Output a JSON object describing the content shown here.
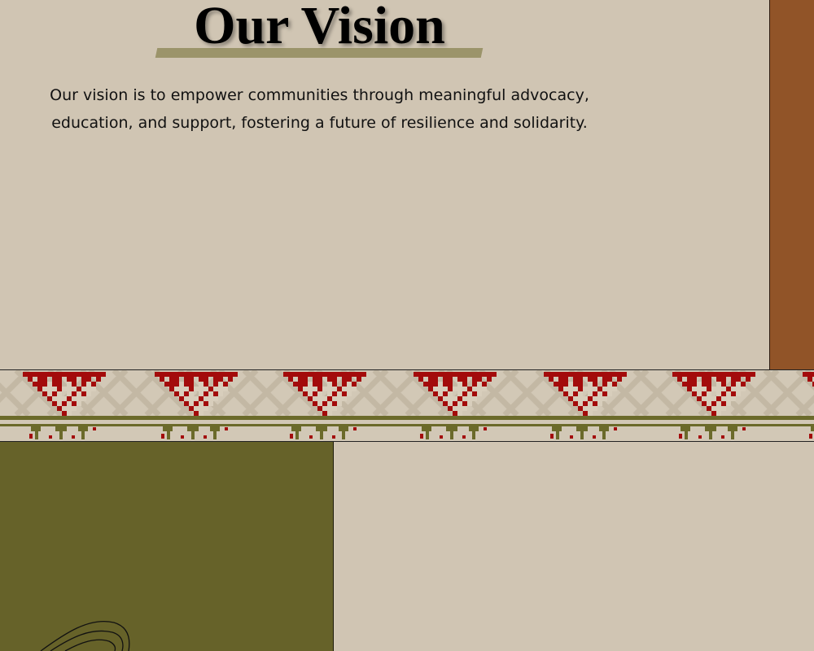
{
  "vision": {
    "title": "Our Vision",
    "text": "Our vision is to empower communities through meaningful advocacy, education, and support, fostering a future of resilience and solidarity."
  },
  "colors": {
    "background": "#d0c5b3",
    "side_panel": "#915428",
    "title_underline": "#9b946a",
    "pattern_red": "#a30b0b",
    "pattern_olive": "#6b6a2a",
    "olive_block": "#666229"
  },
  "icons": {
    "band": "embroidery-pattern-band",
    "sketch": "line-sketch-illustration"
  }
}
